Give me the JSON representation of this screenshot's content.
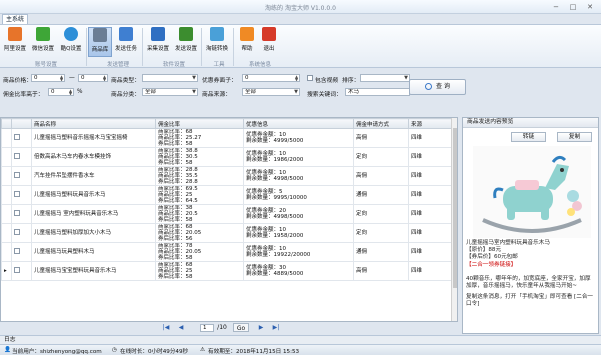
{
  "window": {
    "title": "淘练的 淘宝大师 V1.0.0.0"
  },
  "tabs": [
    {
      "label": "主系统"
    }
  ],
  "ribbon": {
    "buttons": [
      {
        "label": "阿里设置",
        "color": "#e7742a"
      },
      {
        "label": "微信设置",
        "color": "#3ea637"
      },
      {
        "label": "酷Q设置",
        "color": "#2d8fd8"
      },
      {
        "label": "商品库",
        "color": "#6a7d95"
      },
      {
        "label": "发送任务",
        "color": "#3f7fd1"
      },
      {
        "label": "采集设置",
        "color": "#2f6fc2"
      },
      {
        "label": "发送设置",
        "color": "#3c8d2f"
      },
      {
        "label": "淘链转换",
        "color": "#4aa0d8"
      },
      {
        "label": "帮助",
        "color": "#f08a24"
      },
      {
        "label": "退出",
        "color": "#d63b2a"
      }
    ],
    "groups": [
      "账号设置",
      "发送管理",
      "软件设置",
      "工具",
      "系统信息"
    ]
  },
  "filters": {
    "price_label": "商品价格：",
    "price_from": "0",
    "price_to": "0",
    "dash": "—",
    "type_label": "商品类型：",
    "type_value": "",
    "coupon_label": "优惠券面子：",
    "coupon_value": "0",
    "include_video": "包含视频",
    "sort_label": "排序：",
    "sort_value": "",
    "commission_label": "佣金比率高于：",
    "commission_value": "0",
    "percent": "%",
    "category_label": "商品分类：",
    "category_value": "全部",
    "source_label": "商品来源：",
    "source_value": "全部",
    "keyword_label": "搜索关键词：",
    "keyword_value": "木马",
    "query_button": "查 询"
  },
  "table": {
    "columns": [
      "",
      "商品名称",
      "佣金比率",
      "优惠信息",
      "佣金申请方式",
      "来源"
    ],
    "rows": [
      {
        "name": "儿童摇摇马塑料音乐摇摇木马宝宝摇椅",
        "rate": "商家比率：68\n商品比率：25.27\n券后比率：58",
        "coupon": "优惠券金额：10\n剩余数量：4999/5000",
        "method": "高佣",
        "source": "四维"
      },
      {
        "name": "倍数高品木马车内春水车模挂饰",
        "rate": "商家比率：38.8\n商品比率：30.5\n券后比率：58",
        "coupon": "优惠券金额：10\n剩余数量：1986/2000",
        "method": "定向",
        "source": "四维"
      },
      {
        "name": "汽车挂件吊坠摆件香水车",
        "rate": "商家比率：28.8\n商品比率：35.5\n券后比率：28.8",
        "coupon": "优惠券金额：10\n剩余数量：4998/5000",
        "method": "高佣",
        "source": "四维"
      },
      {
        "name": "儿童摇摇马塑料玩具音乐木马",
        "rate": "商家比率：69.5\n商品比率：25\n券后比率：64.5",
        "coupon": "优惠券金额：5\n剩余数量：9995/10000",
        "method": "通佣",
        "source": "四维"
      },
      {
        "name": "儿童摇摇马 室内塑料玩具音乐木马",
        "rate": "商家比率：38\n商品比率：20.5\n券后比率：58",
        "coupon": "优惠券金额：20\n剩余数量：4998/5000",
        "method": "定向",
        "source": "四维"
      },
      {
        "name": "儿童摇摇马塑料加厚加大小木马",
        "rate": "商家比率：68\n商品比率：20.05\n券后比率：56",
        "coupon": "优惠券金额：10\n剩余数量：1958/2000",
        "method": "定向",
        "source": "四维"
      },
      {
        "name": "儿童摇摇马玩具塑料木马",
        "rate": "商家比率：78\n商品比率：20.05\n券后比率：58",
        "coupon": "优惠券金额：10\n剩余数量：19922/20000",
        "method": "通佣",
        "source": "四维"
      },
      {
        "name": "儿童摇摇马宝宝塑料玩具音乐木马",
        "rate": "商家比率：68\n商品比率：25\n券后比率：58",
        "coupon": "优惠券金额：30\n剩余数量：4889/5000",
        "method": "高佣",
        "source": "四维"
      }
    ]
  },
  "pager": {
    "first": "|◀",
    "prev": "◀",
    "page": "1",
    "of": "/10",
    "go": "Go",
    "next": "▶",
    "last": "▶|"
  },
  "preview": {
    "title": "商品发送内容预览",
    "convert_button": "转链",
    "copy_button": "复制",
    "text_line1": "儿童摇摇马室内塑料玩具音乐木马",
    "text_line2": "【原价】88元",
    "text_line3": "【券后价】60元包邮",
    "text_line4": "【二合一领券链接】",
    "text_line5": "40颗音乐，哪年年的，加宽底座，全家开宝，加厚加厚，音乐摇摇马，快乐童年从我摇马开始~",
    "text_line6": "复制这条消息，打开「手机淘宝」即可查看 [二合一口令]"
  },
  "log": {
    "label": "日志"
  },
  "status": {
    "user": "当前用户：shizhenyong@qq.com",
    "online": "在线时长：0小时49分49秒",
    "expiry": "有效期至：2018年11月15日  15:53"
  }
}
